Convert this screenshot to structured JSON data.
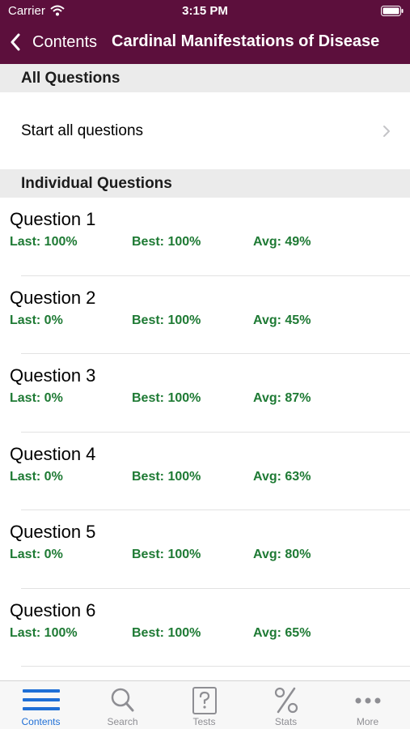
{
  "status_bar": {
    "carrier": "Carrier",
    "time": "3:15 PM"
  },
  "nav": {
    "back_label": "Contents",
    "title": "Cardinal Manifestations of Disease"
  },
  "sections": {
    "all_questions": "All Questions",
    "individual_questions": "Individual Questions"
  },
  "start_all": {
    "label": "Start all questions"
  },
  "questions": [
    {
      "title": "Question 1",
      "last": "Last: 100%",
      "best": "Best: 100%",
      "avg": "Avg: 49%"
    },
    {
      "title": "Question 2",
      "last": "Last: 0%",
      "best": "Best: 100%",
      "avg": "Avg: 45%"
    },
    {
      "title": "Question 3",
      "last": "Last: 0%",
      "best": "Best: 100%",
      "avg": "Avg: 87%"
    },
    {
      "title": "Question 4",
      "last": "Last: 0%",
      "best": "Best: 100%",
      "avg": "Avg: 63%"
    },
    {
      "title": "Question 5",
      "last": "Last: 0%",
      "best": "Best: 100%",
      "avg": "Avg: 80%"
    },
    {
      "title": "Question 6",
      "last": "Last: 100%",
      "best": "Best: 100%",
      "avg": "Avg: 65%"
    }
  ],
  "tabs": [
    {
      "label": "Contents",
      "icon": "hamburger-icon",
      "active": true
    },
    {
      "label": "Search",
      "icon": "search-icon",
      "active": false
    },
    {
      "label": "Tests",
      "icon": "question-page-icon",
      "active": false
    },
    {
      "label": "Stats",
      "icon": "percent-icon",
      "active": false
    },
    {
      "label": "More",
      "icon": "more-dots-icon",
      "active": false
    }
  ],
  "colors": {
    "nav_background": "#5c0f3c",
    "stat_green": "#1e7a34",
    "tab_active": "#1f6fd6",
    "tab_inactive": "#8e8e93"
  }
}
